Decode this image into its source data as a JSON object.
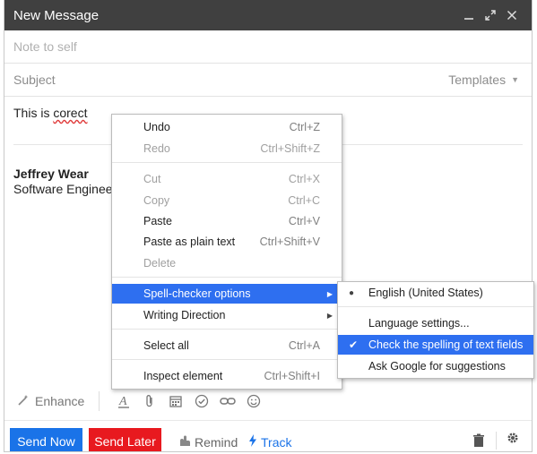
{
  "window": {
    "title": "New Message",
    "minimize_icon": "minimize-icon",
    "expand_icon": "expand-icon",
    "close_icon": "close-icon"
  },
  "recipient": {
    "placeholder": "Note to self"
  },
  "subject": {
    "placeholder": "Subject",
    "templates_label": "Templates"
  },
  "body": {
    "text_prefix": "This is ",
    "misspelled_word": "corect",
    "signature_name": "Jeffrey Wear",
    "signature_title": "Software Engineer"
  },
  "format_toolbar": {
    "enhance_label": "Enhance"
  },
  "actions": {
    "send_now": "Send Now",
    "send_later": "Send Later",
    "remind": "Remind",
    "track": "Track"
  },
  "context_menu": {
    "items": [
      {
        "label": "Undo",
        "shortcut": "Ctrl+Z",
        "enabled": true
      },
      {
        "label": "Redo",
        "shortcut": "Ctrl+Shift+Z",
        "enabled": false
      },
      {
        "label": "Cut",
        "shortcut": "Ctrl+X",
        "enabled": false
      },
      {
        "label": "Copy",
        "shortcut": "Ctrl+C",
        "enabled": false
      },
      {
        "label": "Paste",
        "shortcut": "Ctrl+V",
        "enabled": true
      },
      {
        "label": "Paste as plain text",
        "shortcut": "Ctrl+Shift+V",
        "enabled": true
      },
      {
        "label": "Delete",
        "shortcut": "",
        "enabled": false
      },
      {
        "label": "Spell-checker options",
        "shortcut": "",
        "enabled": true,
        "highlighted": true
      },
      {
        "label": "Writing Direction",
        "shortcut": "",
        "enabled": true
      },
      {
        "label": "Select all",
        "shortcut": "Ctrl+A",
        "enabled": true
      },
      {
        "label": "Inspect element",
        "shortcut": "Ctrl+Shift+I",
        "enabled": true
      }
    ]
  },
  "spell_submenu": {
    "items": [
      {
        "label": "English (United States)",
        "selected": true
      },
      {
        "label": "Language settings..."
      },
      {
        "label": "Check the spelling of text fields",
        "checked": true,
        "highlighted": true
      },
      {
        "label": "Ask Google for suggestions"
      }
    ]
  },
  "colors": {
    "titlebar": "#404040",
    "send_now": "#1a73e8",
    "send_later": "#e8191f",
    "menu_highlight": "#2e6ff0"
  }
}
